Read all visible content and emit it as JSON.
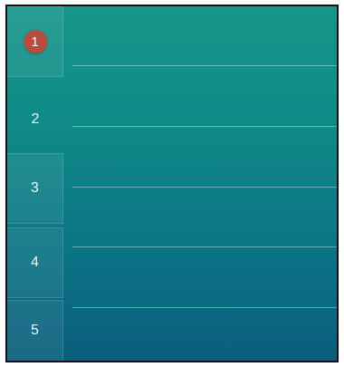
{
  "pages": [
    {
      "label": "1",
      "selected_badge": true
    },
    {
      "label": "2",
      "active": true
    },
    {
      "label": "3"
    },
    {
      "label": "4"
    },
    {
      "label": "5"
    }
  ],
  "colors": {
    "background_top": "#17968a",
    "background_bottom": "#0b5e7c",
    "badge": "#b84b3c",
    "text": "#eef6f6"
  }
}
